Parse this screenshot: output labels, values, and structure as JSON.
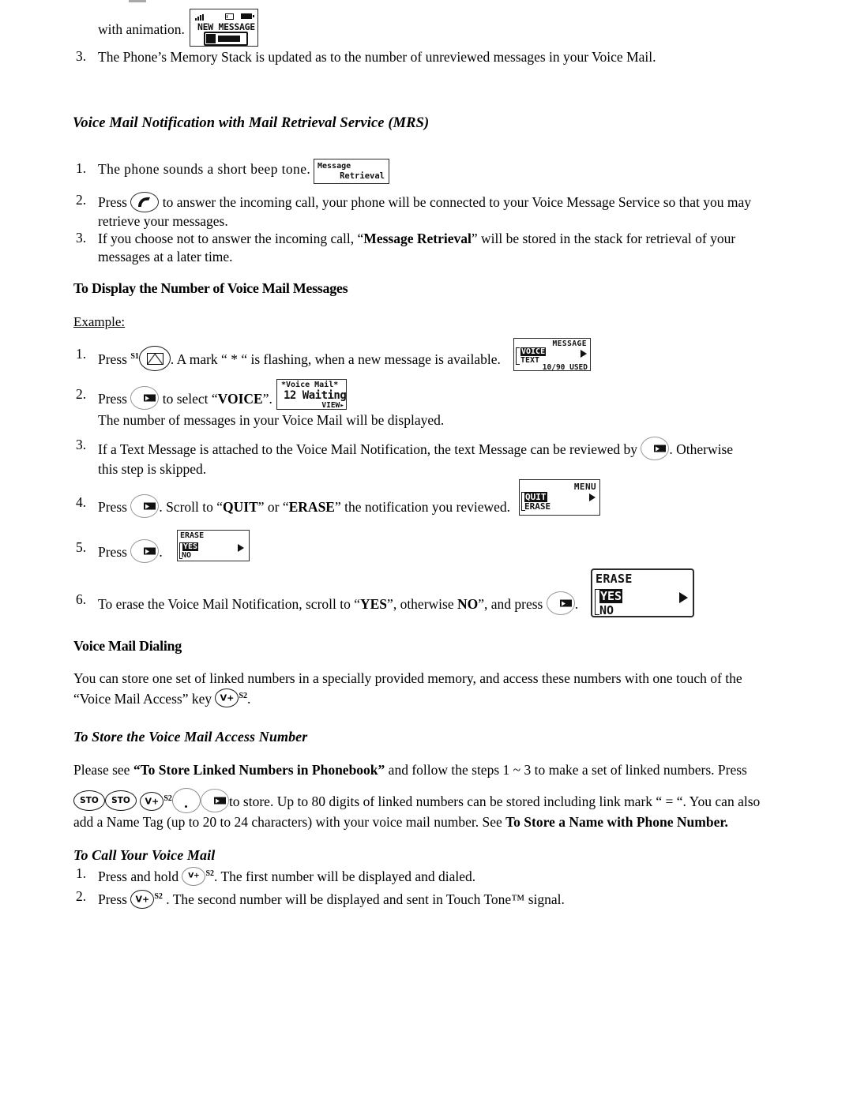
{
  "document": {
    "type": "phone-user-manual-page",
    "top_fragment": {
      "text_before_lcd": "with animation.",
      "lcd": {
        "name": "new-message-lcd",
        "status_icons": [
          "signal-bars-icon",
          "envelope-icon",
          "battery-icon"
        ],
        "line1": "NEW MESSAGE",
        "graphic": "envelope-animation"
      }
    },
    "intro_list": [
      {
        "num": "3.",
        "text": "The Phone’s Memory Stack is updated as to the number of unreviewed messages in your Voice Mail."
      }
    ],
    "section_mrs": {
      "heading": "Voice Mail Notification with Mail Retrieval Service (MRS)",
      "items": [
        {
          "num": "1.",
          "text": "The phone sounds a short beep tone.",
          "lcd": {
            "name": "message-retrieval-lcd",
            "line1": "Message",
            "line2": "Retrieval"
          }
        },
        {
          "num": "2.",
          "pre": "Press",
          "key": "send-key",
          "post": "to answer the incoming call, your phone will be connected to your Voice Message Service so that you may retrieve your messages."
        },
        {
          "num": "3.",
          "pre": "If you choose not to answer the incoming call, “",
          "bold": "Message Retrieval",
          "post": "” will be stored in the stack for retrieval of your messages at a later time."
        }
      ]
    },
    "section_display_count": {
      "heading": "To Display the Number of Voice Mail Messages",
      "example_label": "Example:",
      "items": [
        {
          "num": "1.",
          "pre": "Press",
          "key_sup": "S1",
          "key": "envelope-key",
          "post": ". A mark “ * “ is flashing, when a new message is available.",
          "lcd": {
            "name": "message-menu-lcd",
            "title": "MESSAGE",
            "selected": "VOICE",
            "option2": "TEXT",
            "footer": "10/90 USED",
            "arrow": "right-arrow-icon"
          }
        },
        {
          "num": "2.",
          "pre": "Press",
          "key": "right-soft-key",
          "mid": "to select “",
          "bold": "VOICE",
          "post": "”.",
          "line2": "The number of messages in your Voice Mail will be displayed.",
          "lcd": {
            "name": "voice-mail-waiting-lcd",
            "line1": "*Voice Mail*",
            "line2": "12 Waiting",
            "line3": "VIEW▸"
          }
        },
        {
          "num": "3.",
          "pre": "If a Text Message is attached to the Voice Mail Notification, the text Message can be reviewed by",
          "key": "right-soft-key",
          "post": ". Otherwise this step is skipped."
        },
        {
          "num": "4.",
          "pre": "Press",
          "key": "right-soft-key",
          "mid": ". Scroll to “",
          "bold1": "QUIT",
          "mid2": "” or “",
          "bold2": "ERASE",
          "post": "” the notification you reviewed.",
          "lcd": {
            "name": "quit-erase-menu-lcd",
            "title": "MENU",
            "selected": "QUIT",
            "option2": "ERASE",
            "arrow": "right-arrow-icon"
          }
        },
        {
          "num": "5.",
          "pre": "Press",
          "key": "right-soft-key",
          "post": ".",
          "lcd": {
            "name": "erase-yesno-lcd-small",
            "title": "ERASE",
            "selected": "YES",
            "option2": "NO",
            "arrow": "right-arrow-icon"
          }
        },
        {
          "num": "6.",
          "pre": "To erase the Voice Mail Notification, scroll to “",
          "bold1": "YES",
          "mid": "”, otherwise ",
          "bold2": "NO",
          "mid2": "”, and press",
          "key": "right-soft-key",
          "post": ".",
          "lcd": {
            "name": "erase-yesno-lcd-large",
            "title": "ERASE",
            "selected": "YES",
            "option2": "NO",
            "arrow": "right-arrow-icon"
          }
        }
      ]
    },
    "section_dialing": {
      "heading": "Voice Mail Dialing",
      "paragraph_part1": "You can store one set of linked numbers in a specially provided memory, and access these numbers with one touch of the “Voice Mail Access” key",
      "key_label": "V+",
      "key_sup": "S2",
      "paragraph_end": "."
    },
    "section_store": {
      "heading": "To Store the Voice Mail Access Number",
      "para1_pre": "Please see ",
      "para1_bold": "“To Store Linked Numbers in Phonebook”",
      "para1_post": " and follow the steps 1 ~ 3 to make a set of linked numbers.  Press",
      "keys": [
        "STO",
        "STO",
        "V+"
      ],
      "key_sup": "S2",
      "para2_pre": "to store.  Up to 80 digits of linked numbers can be stored including link mark “ = “.  You can also add a Name Tag (up to 20 to 24 characters) with your voice mail number. See ",
      "para2_bold": "To Store a Name with Phone Number."
    },
    "section_call": {
      "heading": "To Call Your Voice Mail",
      "items": [
        {
          "num": "1.",
          "pre": "Press and hold",
          "key_label": "V+",
          "key_sup": "S2",
          "post": ". The first number will be displayed and dialed."
        },
        {
          "num": "2.",
          "pre": "Press",
          "key_label": "V+",
          "key_sup": "S2",
          "post": " . The second number will be displayed and sent in Touch Tone™ signal."
        }
      ]
    }
  }
}
